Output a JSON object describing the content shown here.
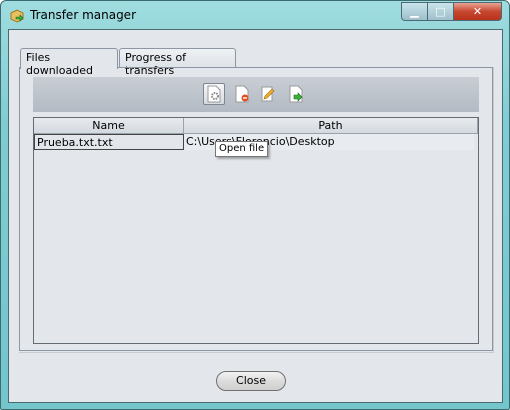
{
  "window": {
    "title": "Transfer manager",
    "minimize": "▁",
    "maximize": "□",
    "close": "✕"
  },
  "tabs": [
    {
      "label": "Files downloaded",
      "active": true
    },
    {
      "label": "Progress of transfers",
      "active": false
    }
  ],
  "toolbar": {
    "buttons": [
      {
        "icon": "open-file-gear-icon"
      },
      {
        "icon": "delete-file-icon"
      },
      {
        "icon": "edit-pencil-icon"
      },
      {
        "icon": "move-file-arrow-icon"
      }
    ],
    "tooltip": "Open file"
  },
  "table": {
    "columns": [
      "Name",
      "Path"
    ],
    "rows": [
      {
        "name": "Prueba.txt.txt",
        "path": "C:\\Users\\Florencio\\Desktop"
      }
    ]
  },
  "footer": {
    "close_label": "Close"
  }
}
